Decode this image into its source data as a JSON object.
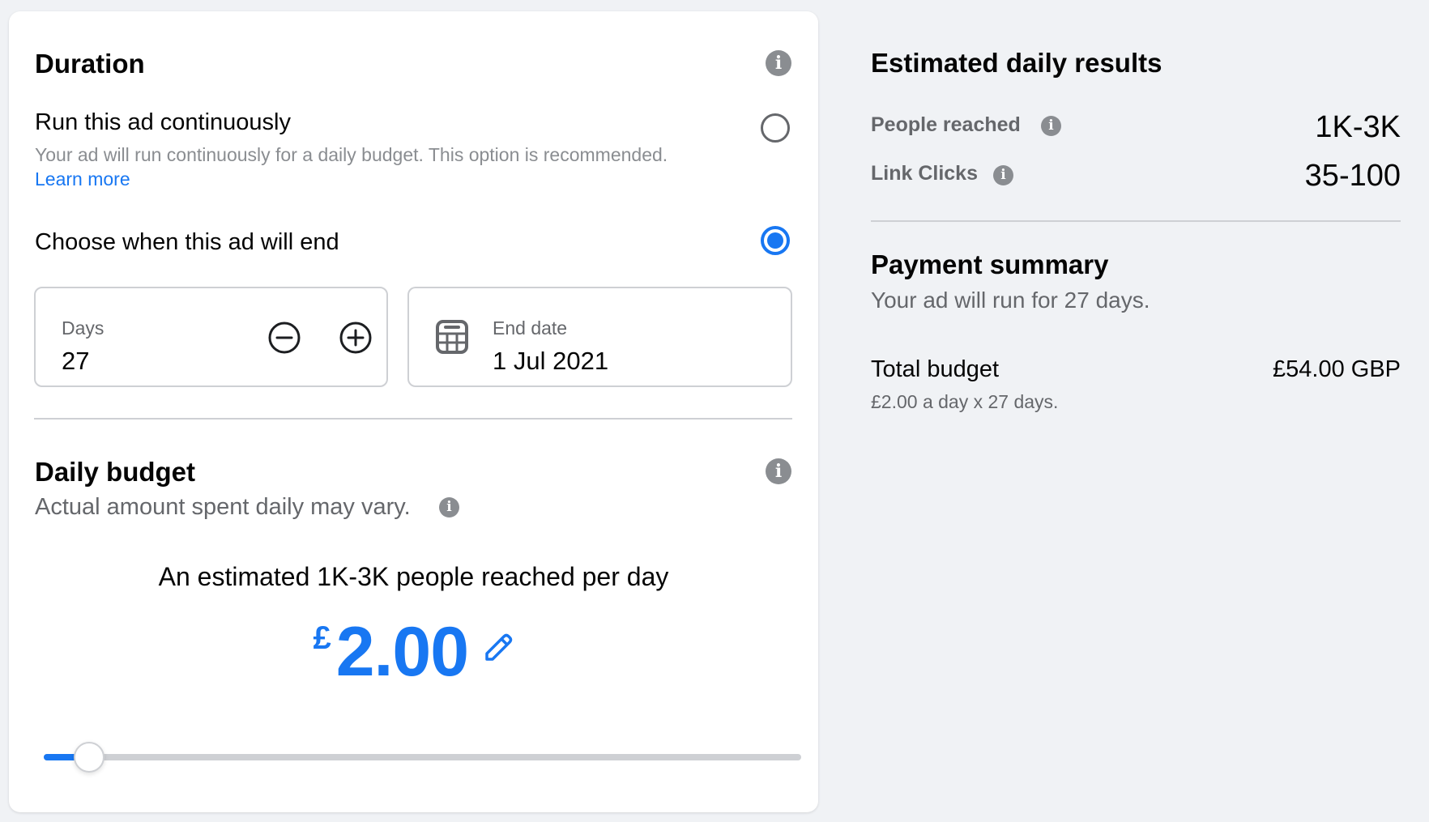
{
  "duration": {
    "title": "Duration",
    "options": [
      {
        "label": "Run this ad continuously",
        "description": "Your ad will run continuously for a daily budget. This option is recommended.",
        "link": "Learn more",
        "selected": false
      },
      {
        "label": "Choose when this ad will end",
        "selected": true
      }
    ],
    "days": {
      "label": "Days",
      "value": "27"
    },
    "end_date": {
      "label": "End date",
      "value": "1 Jul 2021"
    }
  },
  "daily_budget": {
    "title": "Daily budget",
    "subtitle": "Actual amount spent daily may vary.",
    "estimate": "An estimated 1K-3K people reached per day",
    "currency_symbol": "£",
    "amount": "2.00",
    "slider_fraction": 0.06
  },
  "estimated_results": {
    "title": "Estimated daily results",
    "rows": [
      {
        "label": "People reached",
        "value": "1K-3K"
      },
      {
        "label": "Link Clicks",
        "value": "35-100"
      }
    ]
  },
  "payment_summary": {
    "title": "Payment summary",
    "subtitle": "Your ad will run for 27 days.",
    "total_label": "Total budget",
    "total_value": "£54.00 GBP",
    "breakdown": "£2.00 a day x 27 days."
  },
  "icons": {
    "info": "i"
  },
  "colors": {
    "accent": "#1877f2",
    "page_background": "#f0f2f5",
    "secondary_text": "#65676b"
  }
}
